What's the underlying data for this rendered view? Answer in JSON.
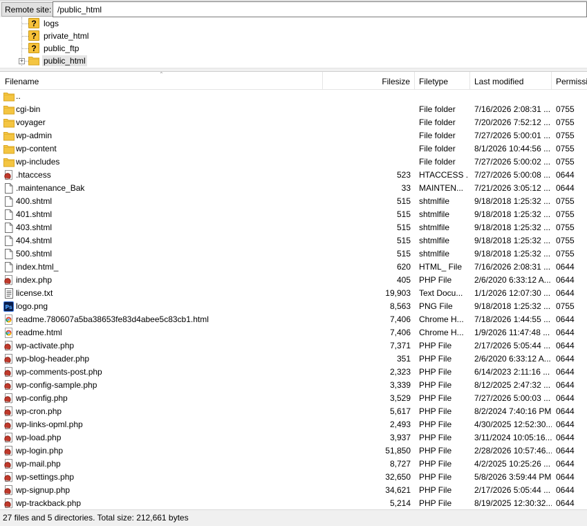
{
  "remote": {
    "label": "Remote site:",
    "path": "/public_html"
  },
  "tree": [
    {
      "label": "logs",
      "icon": "unknown-folder-icon"
    },
    {
      "label": "private_html",
      "icon": "unknown-folder-icon"
    },
    {
      "label": "public_ftp",
      "icon": "unknown-folder-icon"
    },
    {
      "label": "public_html",
      "icon": "folder-icon",
      "selected": true,
      "expander": "+"
    }
  ],
  "columns": {
    "filename": "Filename",
    "filesize": "Filesize",
    "filetype": "Filetype",
    "modified": "Last modified",
    "perms": "Permissi"
  },
  "files": [
    {
      "name": "..",
      "size": "",
      "type": "",
      "modified": "",
      "perms": "",
      "icon": "folder"
    },
    {
      "name": "cgi-bin",
      "size": "",
      "type": "File folder",
      "modified": "7/16/2026 2:08:31 ...",
      "perms": "0755",
      "icon": "folder"
    },
    {
      "name": "voyager",
      "size": "",
      "type": "File folder",
      "modified": "7/20/2026 7:52:12 ...",
      "perms": "0755",
      "icon": "folder"
    },
    {
      "name": "wp-admin",
      "size": "",
      "type": "File folder",
      "modified": "7/27/2026 5:00:01 ...",
      "perms": "0755",
      "icon": "folder"
    },
    {
      "name": "wp-content",
      "size": "",
      "type": "File folder",
      "modified": "8/1/2026 10:44:56 ...",
      "perms": "0755",
      "icon": "folder"
    },
    {
      "name": "wp-includes",
      "size": "",
      "type": "File folder",
      "modified": "7/27/2026 5:00:02 ...",
      "perms": "0755",
      "icon": "folder"
    },
    {
      "name": ".htaccess",
      "size": "523",
      "type": "HTACCESS ...",
      "modified": "7/27/2026 5:00:08 ...",
      "perms": "0644",
      "icon": "script"
    },
    {
      "name": ".maintenance_Bak",
      "size": "33",
      "type": "MAINTEN...",
      "modified": "7/21/2026 3:05:12 ...",
      "perms": "0644",
      "icon": "blank"
    },
    {
      "name": "400.shtml",
      "size": "515",
      "type": "shtmlfile",
      "modified": "9/18/2018 1:25:32 ...",
      "perms": "0755",
      "icon": "blank"
    },
    {
      "name": "401.shtml",
      "size": "515",
      "type": "shtmlfile",
      "modified": "9/18/2018 1:25:32 ...",
      "perms": "0755",
      "icon": "blank"
    },
    {
      "name": "403.shtml",
      "size": "515",
      "type": "shtmlfile",
      "modified": "9/18/2018 1:25:32 ...",
      "perms": "0755",
      "icon": "blank"
    },
    {
      "name": "404.shtml",
      "size": "515",
      "type": "shtmlfile",
      "modified": "9/18/2018 1:25:32 ...",
      "perms": "0755",
      "icon": "blank"
    },
    {
      "name": "500.shtml",
      "size": "515",
      "type": "shtmlfile",
      "modified": "9/18/2018 1:25:32 ...",
      "perms": "0755",
      "icon": "blank"
    },
    {
      "name": "index.html_",
      "size": "620",
      "type": "HTML_ File",
      "modified": "7/16/2026 2:08:31 ...",
      "perms": "0644",
      "icon": "blank"
    },
    {
      "name": "index.php",
      "size": "405",
      "type": "PHP File",
      "modified": "2/6/2020 6:33:12 A...",
      "perms": "0644",
      "icon": "script"
    },
    {
      "name": "license.txt",
      "size": "19,903",
      "type": "Text Docu...",
      "modified": "1/1/2026 12:07:30 ...",
      "perms": "0644",
      "icon": "text"
    },
    {
      "name": "logo.png",
      "size": "8,563",
      "type": "PNG File",
      "modified": "9/18/2018 1:25:32 ...",
      "perms": "0755",
      "icon": "ps"
    },
    {
      "name": "readme.780607a5ba38653fe83d4abee5c83cb1.html",
      "size": "7,406",
      "type": "Chrome H...",
      "modified": "7/18/2026 1:44:55 ...",
      "perms": "0644",
      "icon": "chrome"
    },
    {
      "name": "readme.html",
      "size": "7,406",
      "type": "Chrome H...",
      "modified": "1/9/2026 11:47:48 ...",
      "perms": "0644",
      "icon": "chrome"
    },
    {
      "name": "wp-activate.php",
      "size": "7,371",
      "type": "PHP File",
      "modified": "2/17/2026 5:05:44 ...",
      "perms": "0644",
      "icon": "script"
    },
    {
      "name": "wp-blog-header.php",
      "size": "351",
      "type": "PHP File",
      "modified": "2/6/2020 6:33:12 A...",
      "perms": "0644",
      "icon": "script"
    },
    {
      "name": "wp-comments-post.php",
      "size": "2,323",
      "type": "PHP File",
      "modified": "6/14/2023 2:11:16 ...",
      "perms": "0644",
      "icon": "script"
    },
    {
      "name": "wp-config-sample.php",
      "size": "3,339",
      "type": "PHP File",
      "modified": "8/12/2025 2:47:32 ...",
      "perms": "0644",
      "icon": "script"
    },
    {
      "name": "wp-config.php",
      "size": "3,529",
      "type": "PHP File",
      "modified": "7/27/2026 5:00:03 ...",
      "perms": "0644",
      "icon": "script"
    },
    {
      "name": "wp-cron.php",
      "size": "5,617",
      "type": "PHP File",
      "modified": "8/2/2024 7:40:16 PM",
      "perms": "0644",
      "icon": "script"
    },
    {
      "name": "wp-links-opml.php",
      "size": "2,493",
      "type": "PHP File",
      "modified": "4/30/2025 12:52:30...",
      "perms": "0644",
      "icon": "script"
    },
    {
      "name": "wp-load.php",
      "size": "3,937",
      "type": "PHP File",
      "modified": "3/11/2024 10:05:16...",
      "perms": "0644",
      "icon": "script"
    },
    {
      "name": "wp-login.php",
      "size": "51,850",
      "type": "PHP File",
      "modified": "2/28/2026 10:57:46...",
      "perms": "0644",
      "icon": "script"
    },
    {
      "name": "wp-mail.php",
      "size": "8,727",
      "type": "PHP File",
      "modified": "4/2/2025 10:25:26 ...",
      "perms": "0644",
      "icon": "script"
    },
    {
      "name": "wp-settings.php",
      "size": "32,650",
      "type": "PHP File",
      "modified": "5/8/2026 3:59:44 PM",
      "perms": "0644",
      "icon": "script"
    },
    {
      "name": "wp-signup.php",
      "size": "34,621",
      "type": "PHP File",
      "modified": "2/17/2026 5:05:44 ...",
      "perms": "0644",
      "icon": "script"
    },
    {
      "name": "wp-trackback.php",
      "size": "5,214",
      "type": "PHP File",
      "modified": "8/19/2025 12:30:32...",
      "perms": "0644",
      "icon": "script"
    }
  ],
  "status": "27 files and 5 directories. Total size: 212,661 bytes",
  "colors": {
    "folder": "#f4c542",
    "script": "#c0392b",
    "ps": "#1c3d8c"
  }
}
